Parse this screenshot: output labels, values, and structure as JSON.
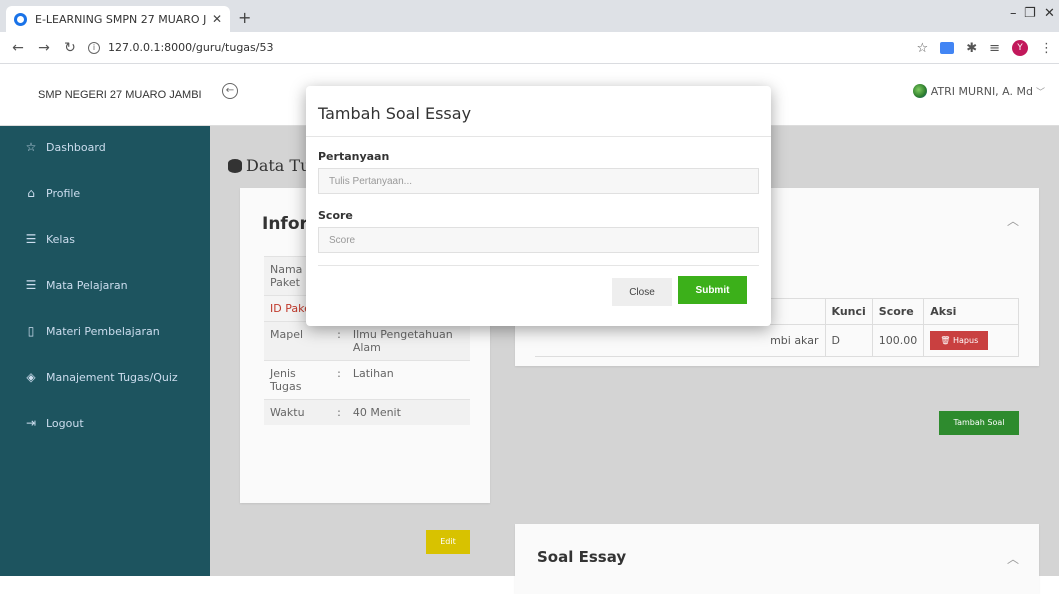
{
  "browser": {
    "tab_title": "E-LEARNING SMPN 27 MUARO J",
    "tab_close": "✕",
    "new_tab": "+",
    "url": "127.0.0.1:8000/guru/tugas/53",
    "profile_initial": "Y"
  },
  "app": {
    "brand": "SMP NEGERI 27 MUARO JAMBI",
    "user_name": "ATRI MURNI, A. Md",
    "page_title": "Data Tugas/Quiz"
  },
  "sidebar": {
    "items": [
      {
        "label": "Dashboard",
        "icon": "star-icon"
      },
      {
        "label": "Profile",
        "icon": "home-icon"
      },
      {
        "label": "Kelas",
        "icon": "database-icon"
      },
      {
        "label": "Mata Pelajaran",
        "icon": "database-icon"
      },
      {
        "label": "Materi Pembelajaran",
        "icon": "tablet-icon"
      },
      {
        "label": "Manajement Tugas/Quiz",
        "icon": "layers-icon"
      },
      {
        "label": "Logout",
        "icon": "logout-icon"
      }
    ]
  },
  "info_card": {
    "title": "Informasi",
    "rows": [
      {
        "key": "Nama Paket",
        "sep": ":",
        "value": ""
      },
      {
        "key": "ID Paket",
        "sep": ":",
        "value": ""
      },
      {
        "key": "Mapel",
        "sep": ":",
        "value": "Ilmu Pengetahuan Alam"
      },
      {
        "key": "Jenis Tugas",
        "sep": ":",
        "value": "Latihan"
      },
      {
        "key": "Waktu",
        "sep": ":",
        "value": "40 Menit"
      }
    ],
    "edit_label": "Edit"
  },
  "soal_card": {
    "headers": {
      "kunci": "Kunci",
      "score": "Score",
      "aksi": "Aksi"
    },
    "row": {
      "pertanyaan": "mbi akar",
      "kunci": "D",
      "score": "100.00"
    },
    "hapus_label": "Hapus",
    "tambah_label": "Tambah Soal"
  },
  "essay_card": {
    "title": "Soal Essay"
  },
  "modal": {
    "title": "Tambah Soal Essay",
    "pertanyaan_label": "Pertanyaan",
    "pertanyaan_placeholder": "Tulis Pertanyaan...",
    "score_label": "Score",
    "score_placeholder": "Score",
    "close_label": "Close",
    "submit_label": "Submit"
  },
  "colors": {
    "sidebar": "#1d545f",
    "submit": "#3cb01a",
    "hapus": "#c94040",
    "edit": "#d8c200",
    "tambah": "#2e8b2e"
  }
}
